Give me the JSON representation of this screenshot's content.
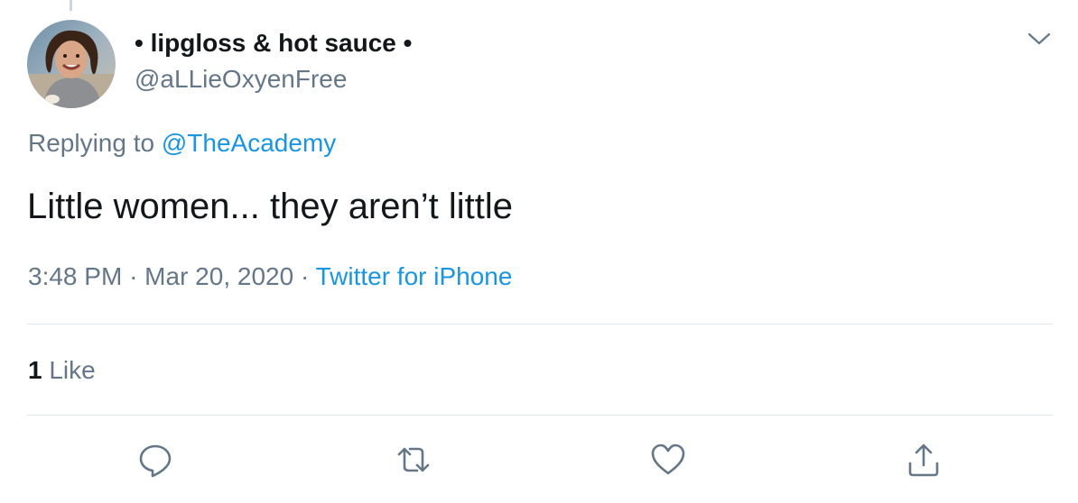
{
  "tweet": {
    "author": {
      "display_name": "• lipgloss & hot sauce •",
      "handle": "@aLLieOxyenFree",
      "avatar_icon": "user-avatar-photo"
    },
    "menu_icon": "chevron-down-icon",
    "replying_to": {
      "prefix": "Replying to",
      "mention": "@TheAcademy"
    },
    "text": "Little women... they aren’t little",
    "meta": {
      "time": "3:48 PM",
      "separator": "·",
      "date": "Mar 20, 2020",
      "source": "Twitter for iPhone"
    },
    "stats": {
      "likes_count": "1",
      "likes_label": "Like"
    },
    "actions": {
      "reply_icon": "reply-icon",
      "retweet_icon": "retweet-icon",
      "like_icon": "heart-icon",
      "share_icon": "share-icon"
    }
  },
  "colors": {
    "text_primary": "#14171a",
    "text_secondary": "#657786",
    "link": "#1b95e0",
    "divider": "#e1e8ed",
    "icon": "#657786"
  }
}
